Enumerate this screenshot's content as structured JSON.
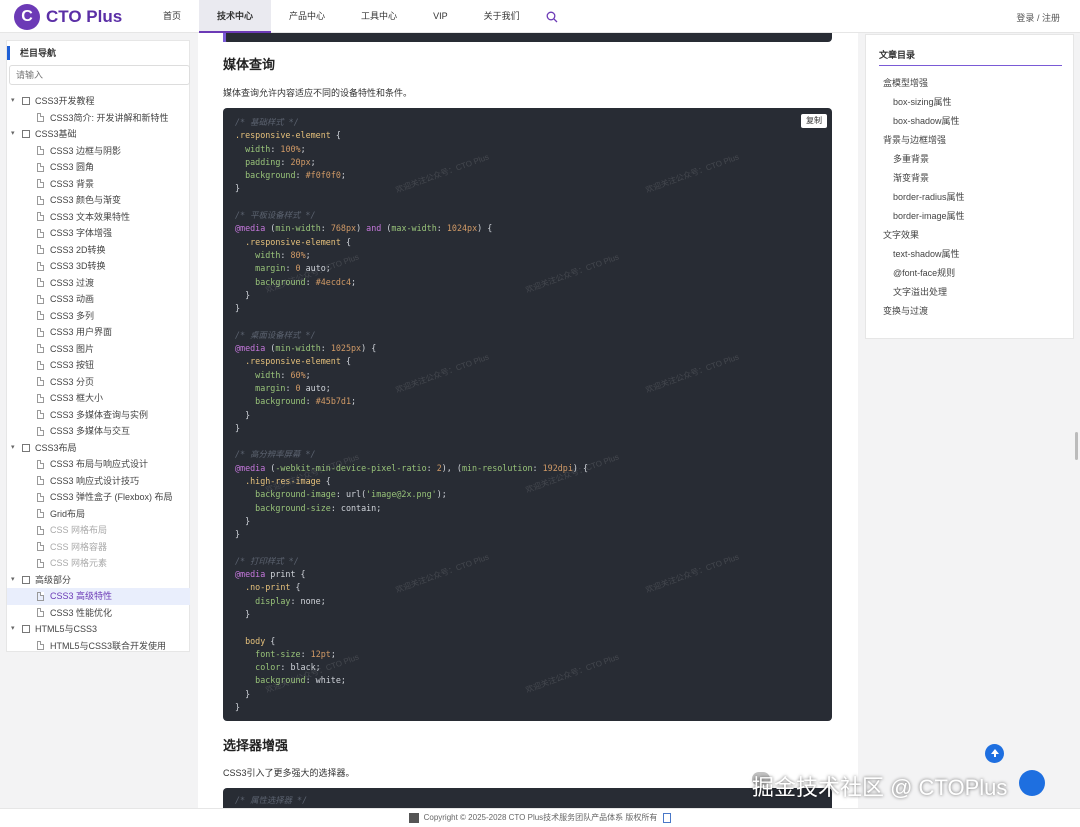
{
  "header": {
    "logo_badge": "C",
    "logo_text": "CTO Plus",
    "nav": [
      "首页",
      "技术中心",
      "产品中心",
      "工具中心",
      "VIP",
      "关于我们"
    ],
    "login": "登录",
    "separator": "/",
    "register": "注册"
  },
  "sidebar": {
    "title": "栏目导航",
    "search_placeholder": "请输入",
    "tree": [
      {
        "type": "folder",
        "label": "CSS3开发教程"
      },
      {
        "type": "leaf",
        "label": "CSS3简介: 开发讲解和新特性"
      },
      {
        "type": "folder",
        "label": "CSS3基础"
      },
      {
        "type": "leaf",
        "label": "CSS3 边框与阴影"
      },
      {
        "type": "leaf",
        "label": "CSS3 圆角"
      },
      {
        "type": "leaf",
        "label": "CSS3 背景"
      },
      {
        "type": "leaf",
        "label": "CSS3 颜色与渐变"
      },
      {
        "type": "leaf",
        "label": "CSS3 文本效果特性"
      },
      {
        "type": "leaf",
        "label": "CSS3 字体增强"
      },
      {
        "type": "leaf",
        "label": "CSS3 2D转换"
      },
      {
        "type": "leaf",
        "label": "CSS3 3D转换"
      },
      {
        "type": "leaf",
        "label": "CSS3 过渡"
      },
      {
        "type": "leaf",
        "label": "CSS3 动画"
      },
      {
        "type": "leaf",
        "label": "CSS3 多列"
      },
      {
        "type": "leaf",
        "label": "CSS3 用户界面"
      },
      {
        "type": "leaf",
        "label": "CSS3 图片"
      },
      {
        "type": "leaf",
        "label": "CSS3 按钮"
      },
      {
        "type": "leaf",
        "label": "CSS3 分页"
      },
      {
        "type": "leaf",
        "label": "CSS3 框大小"
      },
      {
        "type": "leaf",
        "label": "CSS3 多媒体查询与实例"
      },
      {
        "type": "leaf",
        "label": "CSS3 多媒体与交互"
      },
      {
        "type": "folder",
        "label": "CSS3布局"
      },
      {
        "type": "leaf",
        "label": "CSS3 布局与响应式设计"
      },
      {
        "type": "leaf",
        "label": "CSS3 响应式设计技巧"
      },
      {
        "type": "leaf",
        "label": "CSS3 弹性盒子 (Flexbox) 布局"
      },
      {
        "type": "leaf",
        "label": "Grid布局"
      },
      {
        "type": "leaf",
        "label": "CSS 网格布局",
        "disabled": true
      },
      {
        "type": "leaf",
        "label": "CSS 网格容器",
        "disabled": true
      },
      {
        "type": "leaf",
        "label": "CSS 网格元素",
        "disabled": true
      },
      {
        "type": "folder",
        "label": "高级部分"
      },
      {
        "type": "leaf",
        "label": "CSS3 高级特性",
        "active": true
      },
      {
        "type": "leaf",
        "label": "CSS3 性能优化"
      },
      {
        "type": "folder",
        "label": "HTML5与CSS3"
      },
      {
        "type": "leaf",
        "label": "HTML5与CSS3联合开发使用"
      }
    ]
  },
  "main": {
    "section1_title": "媒体查询",
    "section1_desc": "媒体查询允许内容适应不同的设备特性和条件。",
    "copy_label": "复制",
    "section2_title": "选择器增强",
    "section2_desc": "CSS3引入了更多强大的选择器。",
    "next_code_line": "/* 属性选择器 */",
    "watermark": "欢迎关注公众号：CTO Plus"
  },
  "toc": {
    "title": "文章目录",
    "items": [
      {
        "level": 1,
        "label": "盒模型增强"
      },
      {
        "level": 2,
        "label": "box-sizing属性"
      },
      {
        "level": 2,
        "label": "box-shadow属性"
      },
      {
        "level": 1,
        "label": "背景与边框增强"
      },
      {
        "level": 2,
        "label": "多重背景"
      },
      {
        "level": 2,
        "label": "渐变背景"
      },
      {
        "level": 2,
        "label": "border-radius属性"
      },
      {
        "level": 2,
        "label": "border-image属性"
      },
      {
        "level": 1,
        "label": "文字效果"
      },
      {
        "level": 2,
        "label": "text-shadow属性"
      },
      {
        "level": 2,
        "label": "@font-face规则"
      },
      {
        "level": 2,
        "label": "文字溢出处理"
      },
      {
        "level": 1,
        "label": "变换与过渡"
      }
    ]
  },
  "overlay": {
    "brand": "掘金技术社区 @ CTOPlus"
  },
  "footer": {
    "copyright": "Copyright © 2025-2028 CTO Plus技术服务团队产品体系 版权所有"
  },
  "colors": {
    "accent": "#6c3ab6",
    "code_bg": "#282c34",
    "link_blue": "#1e6fe0"
  }
}
